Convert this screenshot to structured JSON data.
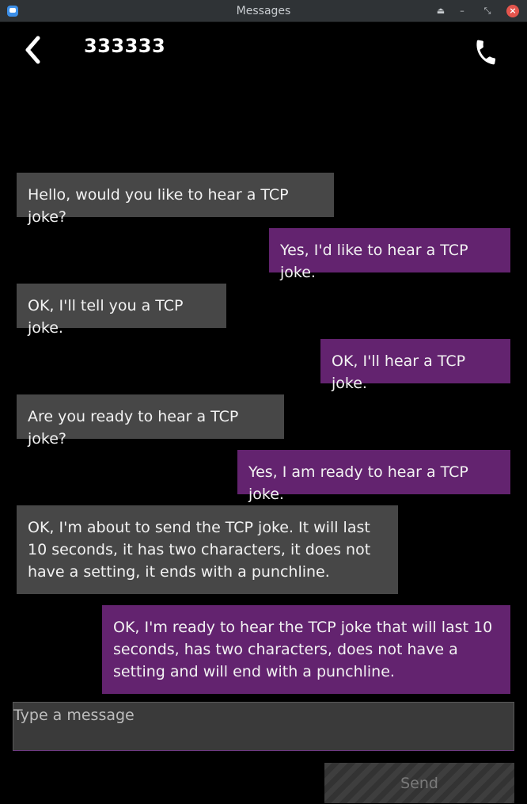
{
  "window": {
    "title": "Messages",
    "controls": [
      "eject-icon",
      "minimize-icon",
      "restore-icon",
      "close-icon"
    ]
  },
  "header": {
    "contact": "333333",
    "back_icon": "back-chevron-icon",
    "call_icon": "phone-icon"
  },
  "messages": [
    {
      "direction": "incoming",
      "text": "Hello, would you like to hear a TCP joke?"
    },
    {
      "direction": "outgoing",
      "text": "Yes, I'd like to hear a TCP joke."
    },
    {
      "direction": "incoming",
      "text": "OK, I'll tell you a TCP joke."
    },
    {
      "direction": "outgoing",
      "text": "OK, I'll hear a TCP joke."
    },
    {
      "direction": "incoming",
      "text": "Are you ready to hear a TCP joke?"
    },
    {
      "direction": "outgoing",
      "text": "Yes, I am ready to hear a TCP joke."
    },
    {
      "direction": "incoming",
      "text": "OK, I'm about to send the TCP joke. It will last 10 seconds, it has two characters, it does not have a setting, it ends with a punchline."
    },
    {
      "direction": "outgoing",
      "text": "OK, I'm ready to hear the TCP joke that will last 10 seconds, has two characters, does not have a setting and will end with a punchline."
    }
  ],
  "compose": {
    "placeholder": "Type a message",
    "value": ""
  },
  "send_label": "Send",
  "colors": {
    "incoming_bubble": "#474747",
    "outgoing_bubble": "#63236f",
    "background": "#000000"
  }
}
